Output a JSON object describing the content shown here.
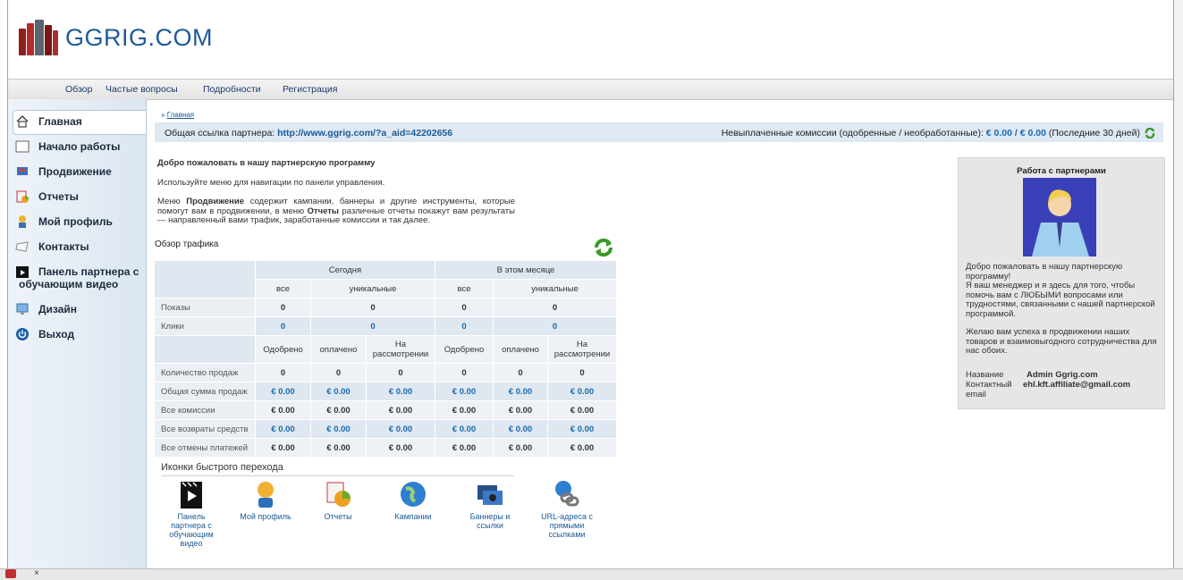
{
  "header": {
    "logo_text": "GGRIG.COM"
  },
  "topnav": [
    {
      "label": "Обзор"
    },
    {
      "label": "Частые вопросы"
    },
    {
      "label": "Подробности"
    },
    {
      "label": "Регистрация"
    }
  ],
  "sidebar": {
    "items": [
      {
        "label": "Главная",
        "icon": "home-icon"
      },
      {
        "label": "Начало работы",
        "icon": "page-icon"
      },
      {
        "label": "Продвижение",
        "icon": "promo-icon"
      },
      {
        "label": "Отчеты",
        "icon": "reports-icon"
      },
      {
        "label": "Мой профиль",
        "icon": "profile-icon"
      },
      {
        "label": "Контакты",
        "icon": "contacts-icon"
      },
      {
        "label": "Панель партнера с",
        "label2": "обучающим видео",
        "icon": "video-icon"
      },
      {
        "label": "Дизайн",
        "icon": "design-icon"
      },
      {
        "label": "Выход",
        "icon": "power-icon"
      }
    ]
  },
  "breadcrumb": {
    "prefix": "»",
    "label": "Главная"
  },
  "linkbar": {
    "left_label": "Общая ссылка партнера:",
    "link": "http://www.ggrig.com/?a_aid=42202656",
    "right_label": "Невыплаченные комиссии (одобренные / необработанные):",
    "commission": "€ 0.00 / € 0.00",
    "period": "(Последние 30 дней)"
  },
  "welcome": {
    "heading": "Добро пожаловать в нашу партнерскую программу",
    "p1": "Используйте меню для навигации по панели управления.",
    "p2_a": "Меню ",
    "p2_b": "Продвижение",
    "p2_c": " содержит кампании, баннеры и другие инструменты, которые помогут вам в продвижении, в меню ",
    "p2_d": "Отчеты",
    "p2_e": " различные отчеты покажут вам результаты — направленный вами трафик, заработанные комиссии и так далее."
  },
  "traffic": {
    "title": "Обзор трафика",
    "today": "Сегодня",
    "month": "В этом месяце",
    "all": "все",
    "unique": "уникальные",
    "rows1": [
      {
        "label": "Показы",
        "v": [
          "0",
          "0",
          "0",
          "0"
        ]
      },
      {
        "label": "Клики",
        "v": [
          "0",
          "0",
          "0",
          "0"
        ]
      }
    ],
    "approved": "Одобрено",
    "paid": "оплачено",
    "pending": "На рассмотрении",
    "rows2": [
      {
        "label": "Количество продаж",
        "v": [
          "0",
          "0",
          "0",
          "0",
          "0",
          "0"
        ]
      },
      {
        "label": "Общая сумма продаж",
        "v": [
          "€ 0.00",
          "€ 0.00",
          "€ 0.00",
          "€ 0.00",
          "€ 0.00",
          "€ 0.00"
        ]
      },
      {
        "label": "Все комиссии",
        "v": [
          "€ 0.00",
          "€ 0.00",
          "€ 0.00",
          "€ 0.00",
          "€ 0.00",
          "€ 0.00"
        ]
      },
      {
        "label": "Все возвраты средств",
        "v": [
          "€ 0.00",
          "€ 0.00",
          "€ 0.00",
          "€ 0.00",
          "€ 0.00",
          "€ 0.00"
        ]
      },
      {
        "label": "Все отмены платежей",
        "v": [
          "€ 0.00",
          "€ 0.00",
          "€ 0.00",
          "€ 0.00",
          "€ 0.00",
          "€ 0.00"
        ]
      }
    ]
  },
  "quick": {
    "title": "Иконки быстрого перехода",
    "items": [
      {
        "label": "Панель партнера с обучающим видео"
      },
      {
        "label": "Мой профиль"
      },
      {
        "label": "Отчеты"
      },
      {
        "label": "Кампании"
      },
      {
        "label": "Баннеры и ссылки"
      },
      {
        "label": "URL-адреса с прямыми ссылками"
      }
    ]
  },
  "manager": {
    "title": "Работа с партнерами",
    "p1": "Добро пожаловать в нашу партнерскую программу!",
    "p2": "Я ваш менеджер и я здесь для того, чтобы помочь вам с ЛЮБЫМИ вопросами или трудностями, связанными с нашей партнерской программой.",
    "p3": "Желаю вам успеха в продвижении наших товаров и взаимовыгодного сотрудничества для нас обоих.",
    "name_label": "Название",
    "name_value": "Admin Ggrig.com",
    "email_label": "Контактный email",
    "email_value": "ehl.kft.affiliate@gmail.com"
  },
  "colors": {
    "link": "#1a5a96",
    "accent": "#1a6ab0"
  }
}
